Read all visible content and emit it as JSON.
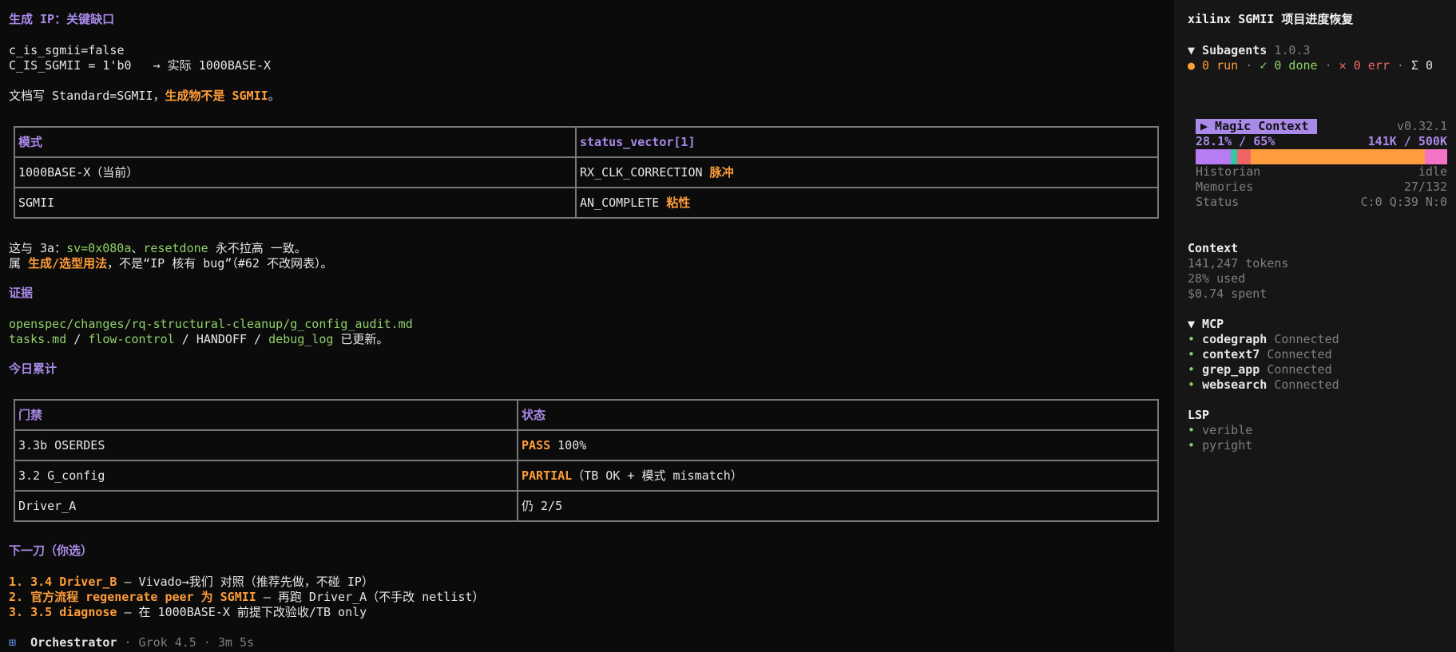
{
  "main": {
    "heading1": "生成 IP：关键缺口",
    "line_sgmii_false": "c_is_sgmii=false",
    "line_c_is_sgmii": "C_IS_SGMII = 1'b0",
    "line_actual_arrow": "→ 实际 1000BASE-X",
    "doc_prefix": "文档写 Standard=SGMII，",
    "doc_highlight": "生成物不是 SGMII",
    "doc_suffix": "。",
    "table1": {
      "headers": [
        "模式",
        "status_vector[1]"
      ],
      "rows": [
        {
          "mode": "1000BASE-X（当前）",
          "value": "RX_CLK_CORRECTION ",
          "value_hl": "脉冲"
        },
        {
          "mode": "SGMII",
          "value": "AN_COMPLETE ",
          "value_hl": "粘性"
        }
      ]
    },
    "consistent_prefix": "这与 3a：",
    "consistent_sv": "sv=0x080a",
    "consistent_sep": "、",
    "consistent_resetdone": "resetdone",
    "consistent_suffix": " 永不拉高 一致。",
    "belongs_prefix": "属 ",
    "belongs_highlight": "生成/选型用法",
    "belongs_suffix": "，不是“IP 核有 bug”（#62 不改网表）。",
    "heading_evidence": "证据",
    "evidence_path": "openspec/changes/rq-structural-cleanup/g_config_audit.md",
    "evidence_tasks": "tasks.md",
    "evidence_slash": " / ",
    "evidence_flow": "flow-control",
    "evidence_handoff": "HANDOFF",
    "evidence_debug": "debug_log",
    "evidence_updated": " 已更新。",
    "heading_today": "今日累计",
    "table2": {
      "headers": [
        "门禁",
        "状态"
      ],
      "rows": [
        {
          "gate": "3.3b OSERDES",
          "status_hl": "PASS",
          "status": " 100%"
        },
        {
          "gate": "3.2 G_config",
          "status_hl": "PARTIAL",
          "status": "（TB OK + 模式 mismatch）"
        },
        {
          "gate": "Driver_A",
          "status_hl": "",
          "status": "仍 2/5"
        }
      ]
    },
    "heading_next": "下一刀（你选）",
    "next_items": [
      {
        "num": "1. ",
        "hl": "3.4 Driver_B",
        "rest": " — Vivado→我们 对照（推荐先做，不碰 IP）"
      },
      {
        "num": "2. ",
        "hl": "官方流程 regenerate peer 为 SGMII",
        "rest": " — 再跑 Driver_A（不手改 netlist）"
      },
      {
        "num": "3. ",
        "hl": "3.5 diagnose",
        "rest": " — 在 1000BASE-X 前提下改验收/TB only"
      }
    ],
    "footer_icon": "⊞",
    "footer_agent": "Orchestrator",
    "footer_meta": " · Grok 4.5 · 3m 5s"
  },
  "sidebar": {
    "title": "xilinx SGMII 项目进度恢复",
    "subagents_label": "▼ Subagents",
    "subagents_version": " 1.0.3",
    "sub_run": "● 0 run",
    "sub_sep": " · ",
    "sub_done": "✓ 0 done",
    "sub_err": "✕ 0 err",
    "sub_total": "Σ 0",
    "magic_label": "▶ Magic Context",
    "magic_version": "v0.32.1",
    "magic_pct": "28.1% / 65%",
    "magic_tokens": "141K / 500K",
    "context_usage": {
      "segments": [
        {
          "name": "purple",
          "fraction": 0.14,
          "color": "#b77cf2"
        },
        {
          "name": "teal",
          "fraction": 0.025,
          "color": "#35c6a5"
        },
        {
          "name": "red",
          "fraction": 0.055,
          "color": "#ef6565"
        },
        {
          "name": "orange",
          "fraction": 0.69,
          "color": "#ff9c3d"
        },
        {
          "name": "pink",
          "fraction": 0.09,
          "color": "#f573c4"
        }
      ]
    },
    "historian_label": "Historian",
    "historian_value": "idle",
    "memories_label": "Memories",
    "memories_value": "27/132",
    "status_label": "Status",
    "status_value": "C:0 Q:39 N:0",
    "context_heading": "Context",
    "context_tokens": "141,247 tokens",
    "context_used": "28% used",
    "context_spent": "$0.74 spent",
    "mcp_heading": "▼ MCP",
    "mcp_items": [
      {
        "name": "codegraph",
        "status": "Connected"
      },
      {
        "name": "context7",
        "status": "Connected"
      },
      {
        "name": "grep_app",
        "status": "Connected"
      },
      {
        "name": "websearch",
        "status": "Connected"
      }
    ],
    "lsp_heading": "LSP",
    "lsp_items": [
      "verible",
      "pyright"
    ]
  },
  "colors": {
    "accent_purple": "#a98ae8",
    "accent_orange": "#ff9d3a",
    "accent_green": "#8fd16a",
    "error_red": "#f06767"
  }
}
